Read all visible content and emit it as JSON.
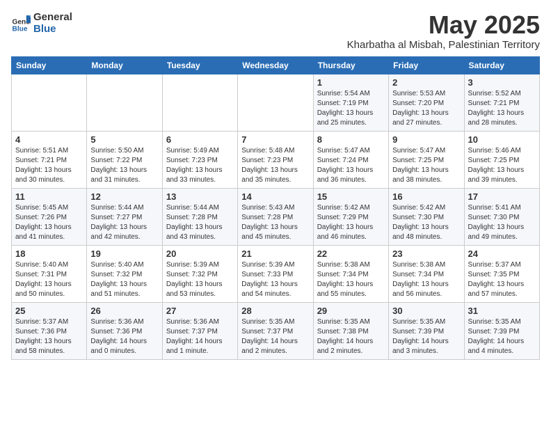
{
  "logo": {
    "general": "General",
    "blue": "Blue"
  },
  "header": {
    "month": "May 2025",
    "location": "Kharbatha al Misbah, Palestinian Territory"
  },
  "weekdays": [
    "Sunday",
    "Monday",
    "Tuesday",
    "Wednesday",
    "Thursday",
    "Friday",
    "Saturday"
  ],
  "weeks": [
    [
      {
        "day": "",
        "info": ""
      },
      {
        "day": "",
        "info": ""
      },
      {
        "day": "",
        "info": ""
      },
      {
        "day": "",
        "info": ""
      },
      {
        "day": "1",
        "info": "Sunrise: 5:54 AM\nSunset: 7:19 PM\nDaylight: 13 hours\nand 25 minutes."
      },
      {
        "day": "2",
        "info": "Sunrise: 5:53 AM\nSunset: 7:20 PM\nDaylight: 13 hours\nand 27 minutes."
      },
      {
        "day": "3",
        "info": "Sunrise: 5:52 AM\nSunset: 7:21 PM\nDaylight: 13 hours\nand 28 minutes."
      }
    ],
    [
      {
        "day": "4",
        "info": "Sunrise: 5:51 AM\nSunset: 7:21 PM\nDaylight: 13 hours\nand 30 minutes."
      },
      {
        "day": "5",
        "info": "Sunrise: 5:50 AM\nSunset: 7:22 PM\nDaylight: 13 hours\nand 31 minutes."
      },
      {
        "day": "6",
        "info": "Sunrise: 5:49 AM\nSunset: 7:23 PM\nDaylight: 13 hours\nand 33 minutes."
      },
      {
        "day": "7",
        "info": "Sunrise: 5:48 AM\nSunset: 7:23 PM\nDaylight: 13 hours\nand 35 minutes."
      },
      {
        "day": "8",
        "info": "Sunrise: 5:47 AM\nSunset: 7:24 PM\nDaylight: 13 hours\nand 36 minutes."
      },
      {
        "day": "9",
        "info": "Sunrise: 5:47 AM\nSunset: 7:25 PM\nDaylight: 13 hours\nand 38 minutes."
      },
      {
        "day": "10",
        "info": "Sunrise: 5:46 AM\nSunset: 7:25 PM\nDaylight: 13 hours\nand 39 minutes."
      }
    ],
    [
      {
        "day": "11",
        "info": "Sunrise: 5:45 AM\nSunset: 7:26 PM\nDaylight: 13 hours\nand 41 minutes."
      },
      {
        "day": "12",
        "info": "Sunrise: 5:44 AM\nSunset: 7:27 PM\nDaylight: 13 hours\nand 42 minutes."
      },
      {
        "day": "13",
        "info": "Sunrise: 5:44 AM\nSunset: 7:28 PM\nDaylight: 13 hours\nand 43 minutes."
      },
      {
        "day": "14",
        "info": "Sunrise: 5:43 AM\nSunset: 7:28 PM\nDaylight: 13 hours\nand 45 minutes."
      },
      {
        "day": "15",
        "info": "Sunrise: 5:42 AM\nSunset: 7:29 PM\nDaylight: 13 hours\nand 46 minutes."
      },
      {
        "day": "16",
        "info": "Sunrise: 5:42 AM\nSunset: 7:30 PM\nDaylight: 13 hours\nand 48 minutes."
      },
      {
        "day": "17",
        "info": "Sunrise: 5:41 AM\nSunset: 7:30 PM\nDaylight: 13 hours\nand 49 minutes."
      }
    ],
    [
      {
        "day": "18",
        "info": "Sunrise: 5:40 AM\nSunset: 7:31 PM\nDaylight: 13 hours\nand 50 minutes."
      },
      {
        "day": "19",
        "info": "Sunrise: 5:40 AM\nSunset: 7:32 PM\nDaylight: 13 hours\nand 51 minutes."
      },
      {
        "day": "20",
        "info": "Sunrise: 5:39 AM\nSunset: 7:32 PM\nDaylight: 13 hours\nand 53 minutes."
      },
      {
        "day": "21",
        "info": "Sunrise: 5:39 AM\nSunset: 7:33 PM\nDaylight: 13 hours\nand 54 minutes."
      },
      {
        "day": "22",
        "info": "Sunrise: 5:38 AM\nSunset: 7:34 PM\nDaylight: 13 hours\nand 55 minutes."
      },
      {
        "day": "23",
        "info": "Sunrise: 5:38 AM\nSunset: 7:34 PM\nDaylight: 13 hours\nand 56 minutes."
      },
      {
        "day": "24",
        "info": "Sunrise: 5:37 AM\nSunset: 7:35 PM\nDaylight: 13 hours\nand 57 minutes."
      }
    ],
    [
      {
        "day": "25",
        "info": "Sunrise: 5:37 AM\nSunset: 7:36 PM\nDaylight: 13 hours\nand 58 minutes."
      },
      {
        "day": "26",
        "info": "Sunrise: 5:36 AM\nSunset: 7:36 PM\nDaylight: 14 hours\nand 0 minutes."
      },
      {
        "day": "27",
        "info": "Sunrise: 5:36 AM\nSunset: 7:37 PM\nDaylight: 14 hours\nand 1 minute."
      },
      {
        "day": "28",
        "info": "Sunrise: 5:35 AM\nSunset: 7:37 PM\nDaylight: 14 hours\nand 2 minutes."
      },
      {
        "day": "29",
        "info": "Sunrise: 5:35 AM\nSunset: 7:38 PM\nDaylight: 14 hours\nand 2 minutes."
      },
      {
        "day": "30",
        "info": "Sunrise: 5:35 AM\nSunset: 7:39 PM\nDaylight: 14 hours\nand 3 minutes."
      },
      {
        "day": "31",
        "info": "Sunrise: 5:35 AM\nSunset: 7:39 PM\nDaylight: 14 hours\nand 4 minutes."
      }
    ]
  ]
}
